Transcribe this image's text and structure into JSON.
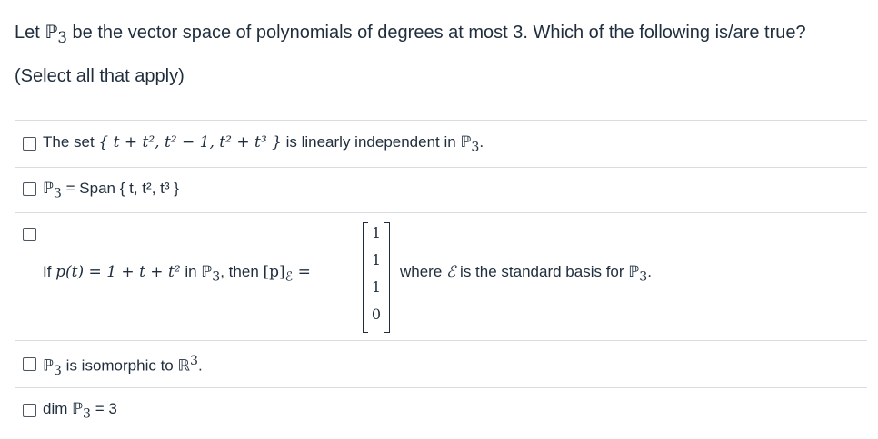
{
  "question": {
    "prefix": "Let ",
    "space": "ℙ",
    "space_sub": "3",
    "suffix": " be the vector space of polynomials of degrees at most 3.  Which of the following is/are true?"
  },
  "instruction": "(Select all that apply)",
  "options": [
    {
      "id": "linearly-independent",
      "parts": {
        "a": "The set ",
        "set": "{ t + t², t² − 1, t² + t³ }",
        "b": " is linearly independent in ",
        "space": "ℙ",
        "sub": "3",
        "c": "."
      }
    },
    {
      "id": "span",
      "parts": {
        "space": "ℙ",
        "sub": "3",
        "a": " = Span { t, t², t³ }"
      }
    },
    {
      "id": "coordinate-vector",
      "parts": {
        "a": "If ",
        "poly": "p(t) = 1 + t + t²",
        "b": " in ",
        "space": "ℙ",
        "sub": "3",
        "c": ", then ",
        "coord": "[p]",
        "coord_sub": "ℰ",
        "eq": " ="
      },
      "vector": [
        "1",
        "1",
        "1",
        "0"
      ],
      "where": {
        "a": "where ",
        "basis": "ℰ",
        "b": " is the standard basis for ",
        "space": "ℙ",
        "sub": "3",
        "c": "."
      }
    },
    {
      "id": "isomorphic",
      "parts": {
        "space": "ℙ",
        "sub": "3",
        "a": " is isomorphic to ",
        "rspace": "ℝ",
        "rsup": "3",
        "b": "."
      }
    },
    {
      "id": "dimension",
      "parts": {
        "a": "dim ",
        "space": "ℙ",
        "sub": "3",
        "b": " = 3"
      }
    }
  ]
}
